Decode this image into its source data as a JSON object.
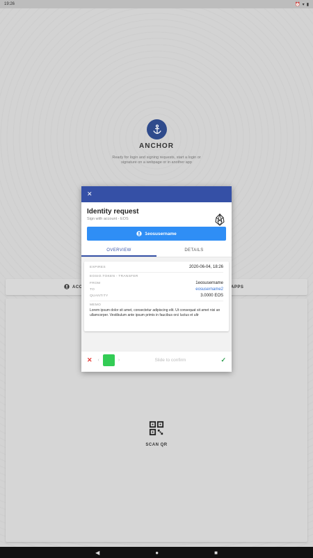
{
  "status_bar": {
    "time": "19:26"
  },
  "brand": {
    "name": "ANCHOR",
    "tagline": "Ready for login and signing requests, start a login or signature on a webpage or in another app"
  },
  "app": {
    "accounts_label": "ACCOUNTS",
    "accounts_visible": "ACC",
    "apps_label": "APPS",
    "scan_qr_label": "SCAN QR"
  },
  "modal": {
    "title": "Identity request",
    "subtitle": "Sign with account - EOS",
    "account_button": "1eosusername",
    "tabs": [
      {
        "label": "OVERVIEW",
        "active": true
      },
      {
        "label": "DETAILS",
        "active": false
      }
    ],
    "expires_label": "EXPIRES",
    "expires_value": "2020-06-04, 18:26",
    "action_label": "EOSIO.TOKEN - TRANSFER",
    "from_label": "FROM",
    "from_value": "1eosusername",
    "to_label": "TO",
    "to_value": "eosusername2",
    "quantity_label": "QUANTITY",
    "quantity_value": "3.0000 EOS",
    "memo_label": "MEMO",
    "memo_text": "Lorem ipsum dolor sit amet, consectetur adipiscing elit. Ut consequat sit amet nisi an ullamcorper. Vestibulum ante ipsum primis in faucibus orci luctus et ultr",
    "slide_label": "Slide to confirm"
  },
  "colors": {
    "header": "#3550a6",
    "primary_button": "#2f8ef5",
    "slider_knob": "#33cc55",
    "cancel": "#e53935",
    "confirm": "#2e9e4f"
  }
}
